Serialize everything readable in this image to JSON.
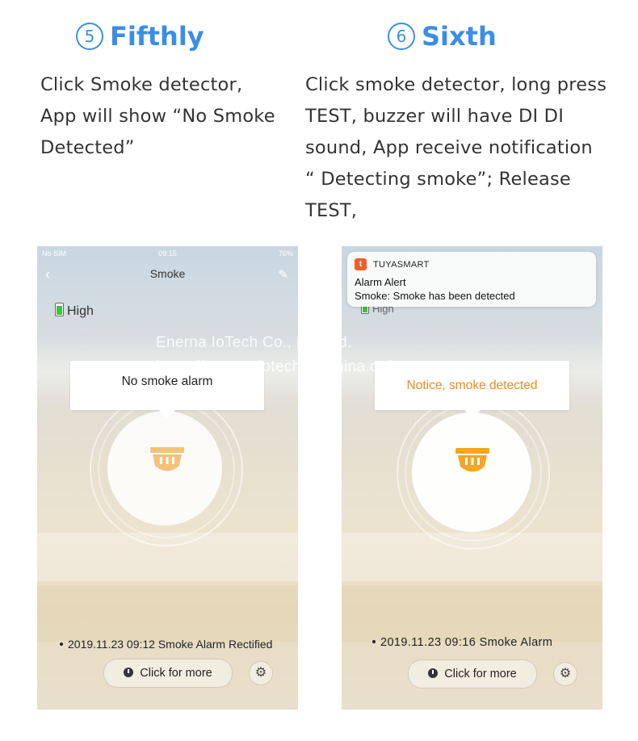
{
  "steps": [
    {
      "number": "5",
      "title": "Fifthly",
      "description": [
        "Click Smoke detector,",
        "App will show “No Smoke",
        "Detected”"
      ]
    },
    {
      "number": "6",
      "title": "Sixth",
      "description": [
        "Click smoke detector, long press",
        "TEST, buzzer will have DI DI",
        "sound, App receive notification",
        "“ Detecting smoke”; Release",
        "TEST,"
      ]
    }
  ],
  "phone_left": {
    "status": {
      "carrier": "No SIM",
      "time": "09:15",
      "battery": "76%"
    },
    "nav_title": "Smoke",
    "battery_label": "High",
    "bubble_text": "No smoke alarm",
    "log_entry": "2019.11.23 09:12 Smoke Alarm Rectified",
    "more_button": "Click for more"
  },
  "phone_right": {
    "notification": {
      "app_name": "TUYASMART",
      "app_icon_letter": "t",
      "title": "Alarm Alert",
      "body": "Smoke: Smoke has been detected"
    },
    "battery_label": "High",
    "bubble_text": "Notice, smoke detected",
    "log_entry": "2019.11.23 09:16 Smoke Alarm",
    "more_button": "Click for more"
  },
  "watermark": {
    "line1": "Enerna IoTech Co., Limited.",
    "line2": "https://enerna-iotech.en.china.cn/"
  },
  "colors": {
    "accent_blue": "#3a8ee6",
    "alert_orange": "#f08a1c",
    "detector_icon_pale": "#f3c27a",
    "detector_icon_alert": "#f5a623"
  }
}
